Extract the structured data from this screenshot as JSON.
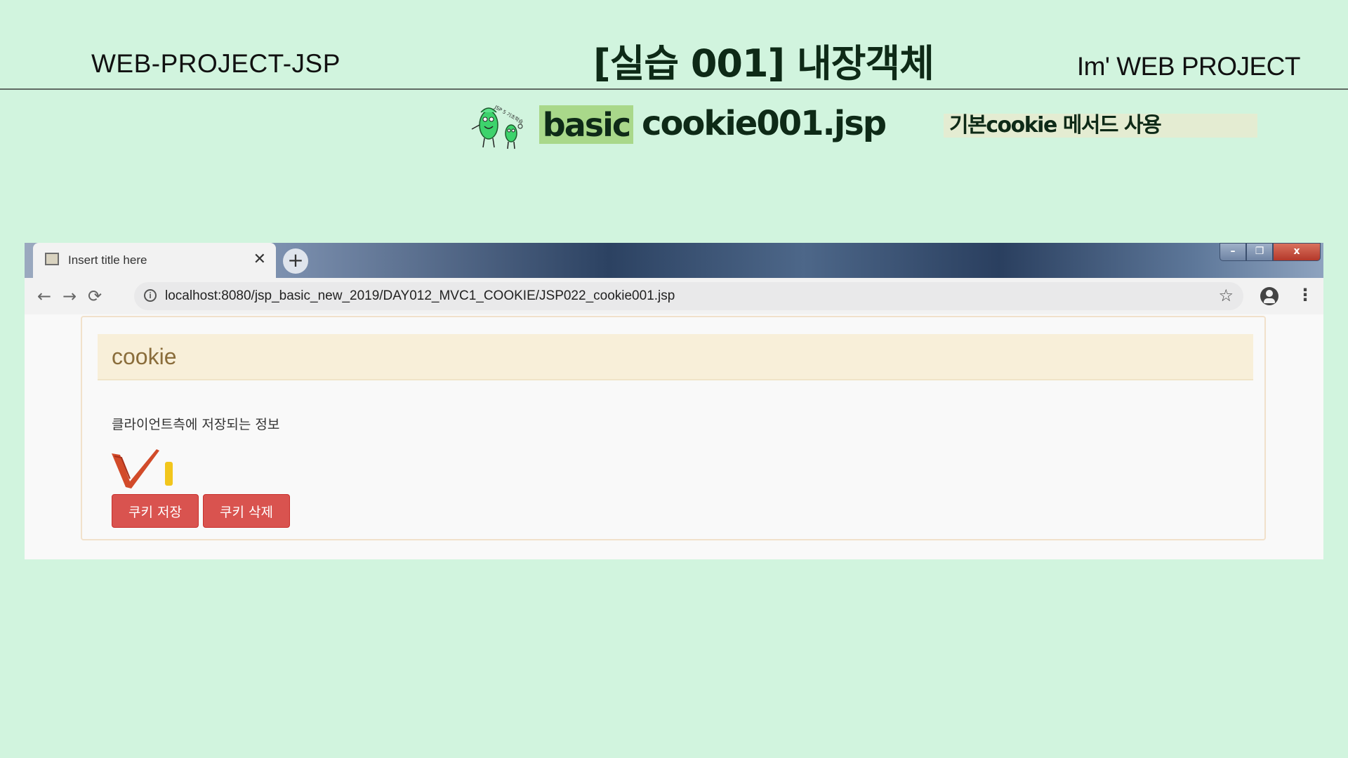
{
  "slide": {
    "left_title": "WEB-PROJECT-JSP",
    "main_title": "[실습 001]  내장객체",
    "right_title": "Im'  WEB PROJECT",
    "badge": "basic",
    "filename": "cookie001.jsp",
    "description": "기본cookie 메서드 사용",
    "mascot_text": "JSP 5 기초학습"
  },
  "browser": {
    "tab_title": "Insert title here",
    "tab_close": "✕",
    "new_tab": "+",
    "window_controls": [
      "–",
      "❐",
      "x"
    ],
    "nav": {
      "back": "←",
      "forward": "→",
      "reload": "⟳"
    },
    "url": "localhost:8080/jsp_basic_new_2019/DAY012_MVC1_COOKIE/JSP022_cookie001.jsp",
    "info": "i",
    "star": "☆",
    "menu": "⋮"
  },
  "page": {
    "heading": "cookie",
    "text": "클라이언트측에 저장되는 정보",
    "save_button": "쿠키 저장",
    "delete_button": "쿠키 삭제"
  },
  "colors": {
    "slide_background": "#d1f4de",
    "badge": "#a9d88a",
    "button": "#d9534f",
    "panel_heading": "#f8efd9"
  }
}
